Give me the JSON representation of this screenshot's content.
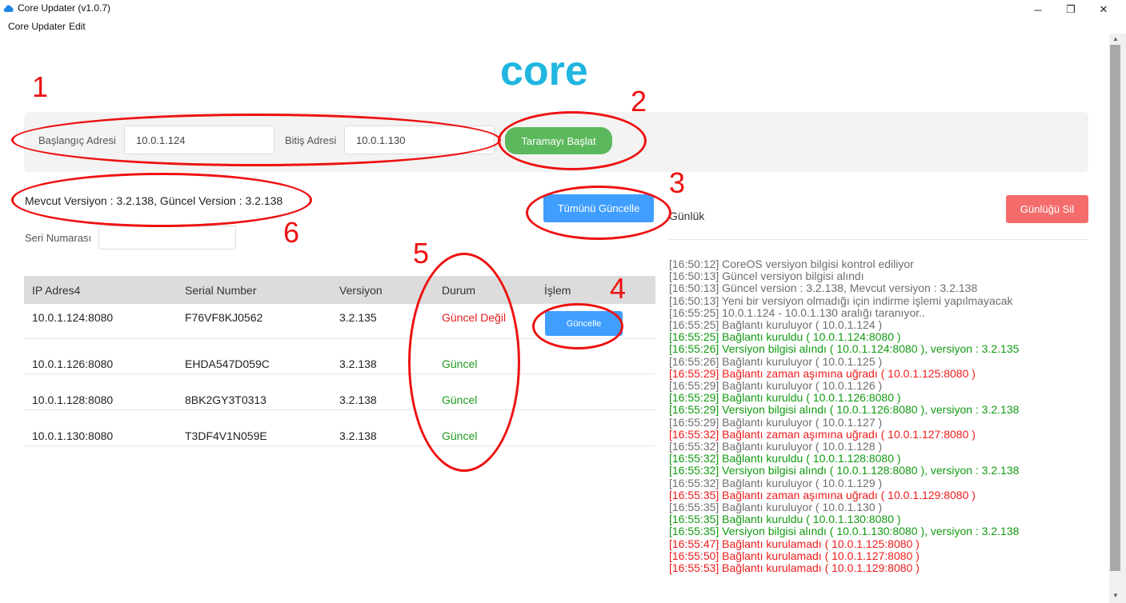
{
  "window": {
    "title": "Core Updater (v1.0.7)",
    "minimize": "─",
    "maximize": "❐",
    "close": "✕"
  },
  "menu": {
    "items": [
      "Core Updater",
      "Edit"
    ]
  },
  "logo": {
    "text": "core"
  },
  "scan": {
    "start_label": "Başlangıç Adresi",
    "start_value": "10.0.1.124",
    "end_label": "Bitiş Adresi",
    "end_value": "10.0.1.130",
    "start_button": "Taramayı Başlat"
  },
  "version_info": "Mevcut Versiyon : 3.2.138, Güncel Version : 3.2.138",
  "update_all_button": "Tümünü Güncelle",
  "serial": {
    "label": "Seri Numarası",
    "value": ""
  },
  "table": {
    "headers": [
      "IP Adres4",
      "Serial Number",
      "Versiyon",
      "Durum",
      "İşlem"
    ],
    "rows": [
      {
        "ip": "10.0.1.124:8080",
        "serial": "F76VF8KJ0562",
        "version": "3.2.135",
        "status": "Güncel Değil",
        "action": "Güncelle"
      },
      {
        "ip": "10.0.1.126:8080",
        "serial": "EHDA547D059C",
        "version": "3.2.138",
        "status": "Güncel"
      },
      {
        "ip": "10.0.1.128:8080",
        "serial": "8BK2GY3T0313",
        "version": "3.2.138",
        "status": "Güncel"
      },
      {
        "ip": "10.0.1.130:8080",
        "serial": "T3DF4V1N059E",
        "version": "3.2.138",
        "status": "Güncel"
      }
    ]
  },
  "log": {
    "title": "Günlük",
    "clear_button": "Günlüğü Sil",
    "entries": [
      "[16:50:12] CoreOS versiyon bilgisi kontrol ediliyor",
      "[16:50:13] Güncel versiyon bilgisi alındı",
      "[16:50:13] Güncel version : 3.2.138, Mevcut versiyon : 3.2.138",
      "[16:50:13] Yeni bir versiyon olmadığı için indirme işlemi yapılmayacak",
      "[16:55:25] 10.0.1.124 - 10.0.1.130 aralığı taranıyor..",
      "[16:55:25] Bağlantı kuruluyor ( 10.0.1.124 )",
      "[16:55:25] Bağlantı kuruldu ( 10.0.1.124:8080 )",
      "[16:55:26] Versiyon bilgisi alındı ( 10.0.1.124:8080 ), versiyon : 3.2.135",
      "[16:55:26] Bağlantı kuruluyor ( 10.0.1.125 )",
      "[16:55:29] Bağlantı zaman aşımına uğradı ( 10.0.1.125:8080 )",
      "[16:55:29] Bağlantı kuruluyor ( 10.0.1.126 )",
      "[16:55:29] Bağlantı kuruldu ( 10.0.1.126:8080 )",
      "[16:55:29] Versiyon bilgisi alındı ( 10.0.1.126:8080 ), versiyon : 3.2.138",
      "[16:55:29] Bağlantı kuruluyor ( 10.0.1.127 )",
      "[16:55:32] Bağlantı zaman aşımına uğradı ( 10.0.1.127:8080 )",
      "[16:55:32] Bağlantı kuruluyor ( 10.0.1.128 )",
      "[16:55:32] Bağlantı kuruldu ( 10.0.1.128:8080 )",
      "[16:55:32] Versiyon bilgisi alındı ( 10.0.1.128:8080 ), versiyon : 3.2.138",
      "[16:55:32] Bağlantı kuruluyor ( 10.0.1.129 )",
      "[16:55:35] Bağlantı zaman aşımına uğradı ( 10.0.1.129:8080 )",
      "[16:55:35] Bağlantı kuruluyor ( 10.0.1.130 )",
      "[16:55:35] Bağlantı kuruldu ( 10.0.1.130:8080 )",
      "[16:55:35] Versiyon bilgisi alındı ( 10.0.1.130:8080 ), versiyon : 3.2.138",
      "[16:55:47] Bağlantı kurulamadı ( 10.0.1.125:8080 )",
      "[16:55:50] Bağlantı kurulamadı ( 10.0.1.127:8080 )",
      "[16:55:53] Bağlantı kurulamadı ( 10.0.1.129:8080 )"
    ],
    "entry_colors": [
      "gray",
      "gray",
      "gray",
      "gray",
      "gray",
      "gray",
      "green",
      "green",
      "gray",
      "red",
      "gray",
      "green",
      "green",
      "gray",
      "red",
      "gray",
      "green",
      "green",
      "gray",
      "red",
      "gray",
      "green",
      "green",
      "red",
      "red",
      "red"
    ]
  },
  "annotations": [
    "1",
    "2",
    "3",
    "4",
    "5",
    "6"
  ],
  "colors": {
    "accent_blue": "#409eff",
    "accent_green": "#5cb85c",
    "danger_red": "#f56c6c",
    "logo_cyan": "#1fb6e0",
    "annotation_red": "#ee1111"
  }
}
